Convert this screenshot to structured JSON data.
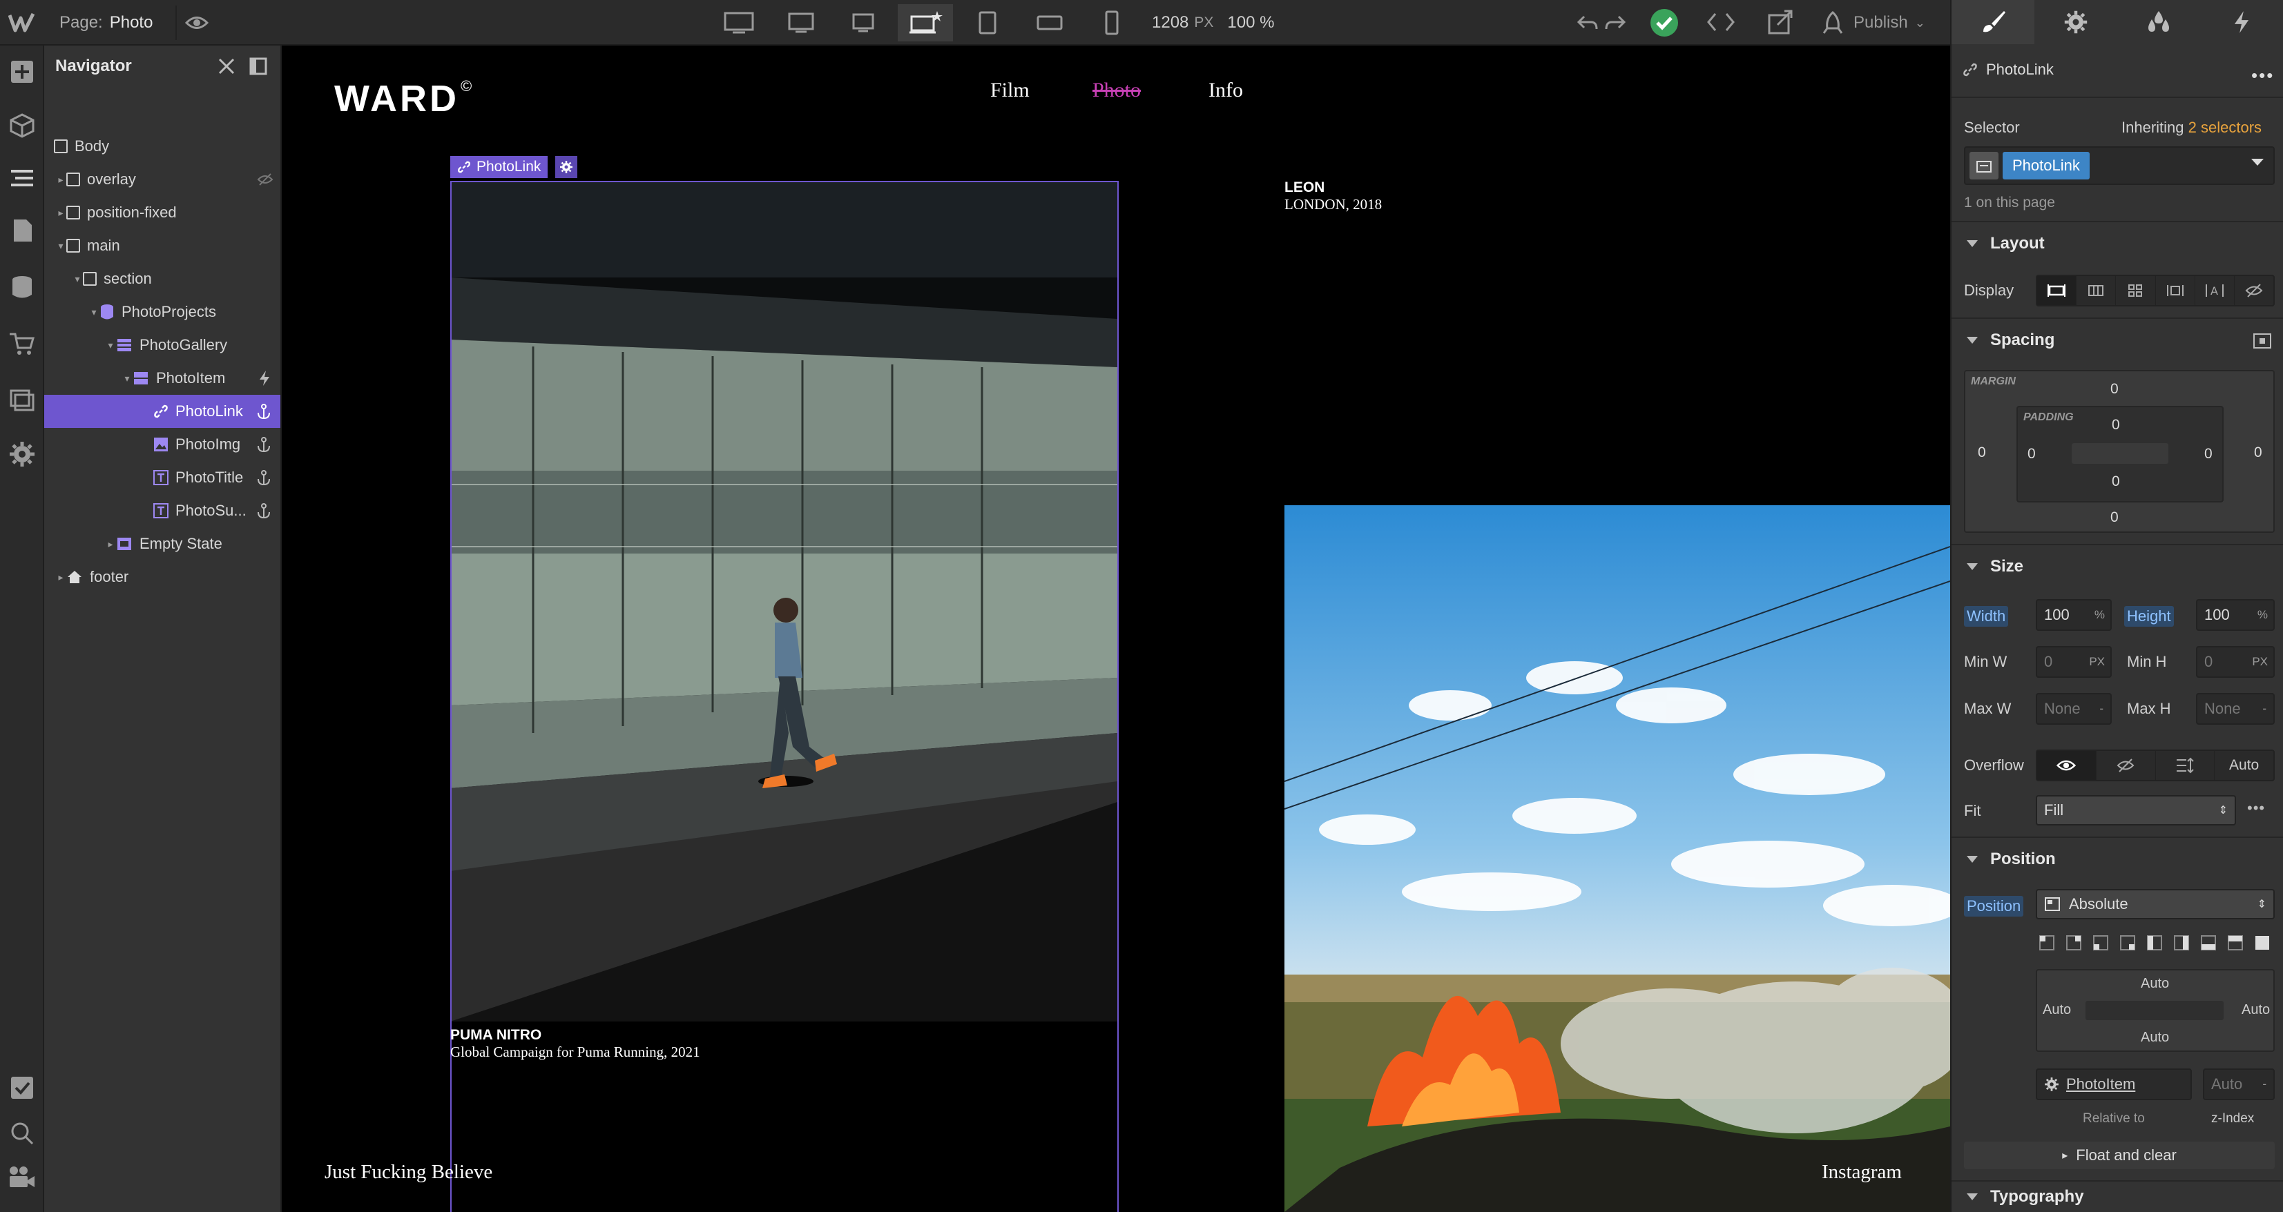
{
  "topbar": {
    "page_label": "Page:",
    "page_name": "Photo",
    "width_value": "1208",
    "width_unit": "PX",
    "zoom": "100 %",
    "publish_label": "Publish"
  },
  "navigator": {
    "title": "Navigator",
    "items": [
      {
        "label": "Body",
        "icon": "box-icon"
      },
      {
        "label": "overlay",
        "icon": "box-icon"
      },
      {
        "label": "position-fixed",
        "icon": "box-icon"
      },
      {
        "label": "main",
        "icon": "box-icon"
      },
      {
        "label": "section",
        "icon": "box-icon"
      },
      {
        "label": "PhotoProjects",
        "icon": "collection-icon"
      },
      {
        "label": "PhotoGallery",
        "icon": "collection-list-icon"
      },
      {
        "label": "PhotoItem",
        "icon": "collection-item-icon"
      },
      {
        "label": "PhotoLink",
        "icon": "link-icon"
      },
      {
        "label": "PhotoImg",
        "icon": "image-icon"
      },
      {
        "label": "PhotoTitle",
        "icon": "text-icon"
      },
      {
        "label": "PhotoSu...",
        "icon": "text-icon"
      },
      {
        "label": "Empty State",
        "icon": "empty-state-icon"
      },
      {
        "label": "footer",
        "icon": "home-icon"
      }
    ]
  },
  "site": {
    "logo": "WARD",
    "logo_mark": "©",
    "nav": [
      "Film",
      "Photo",
      "Info"
    ],
    "selected_tag": "PhotoLink",
    "project1_title": "PUMA NITRO",
    "project1_sub": "Global Campaign for Puma Running, 2021",
    "project2_title": "LEON",
    "project2_sub": "LONDON, 2018",
    "footer_left": "Just Fucking Believe",
    "footer_right": "Instagram"
  },
  "style": {
    "element_name": "PhotoLink",
    "selector_label": "Selector",
    "inheriting_prefix": "Inheriting",
    "inheriting_count": "2 selectors",
    "selector_chip": "PhotoLink",
    "on_page": "1 on this page",
    "layout": {
      "title": "Layout",
      "display_label": "Display"
    },
    "spacing": {
      "title": "Spacing",
      "margin_label": "MARGIN",
      "padding_label": "PADDING",
      "margin": {
        "top": "0",
        "right": "0",
        "bottom": "0",
        "left": "0"
      },
      "padding": {
        "top": "0",
        "right": "0",
        "bottom": "0",
        "left": "0"
      }
    },
    "size": {
      "title": "Size",
      "width_label": "Width",
      "width_value": "100",
      "width_unit": "%",
      "height_label": "Height",
      "height_value": "100",
      "height_unit": "%",
      "minw_label": "Min W",
      "minw_value": "0",
      "minw_unit": "PX",
      "minh_label": "Min H",
      "minh_value": "0",
      "minh_unit": "PX",
      "maxw_label": "Max W",
      "maxw_value": "None",
      "maxw_unit": "-",
      "maxh_label": "Max H",
      "maxh_value": "None",
      "maxh_unit": "-",
      "overflow_label": "Overflow",
      "overflow_auto": "Auto",
      "fit_label": "Fit",
      "fit_value": "Fill"
    },
    "position": {
      "title": "Position",
      "position_label": "Position",
      "position_value": "Absolute",
      "top": "Auto",
      "left": "Auto",
      "right": "Auto",
      "bottom": "Auto",
      "relative_item": "PhotoItem",
      "z_value": "Auto",
      "relative_to_label": "Relative to",
      "zindex_label": "z-Index",
      "float_label": "Float and clear"
    },
    "typography": {
      "title": "Typography"
    }
  },
  "colors": {
    "accent_purple": "#6e56cf",
    "link_pink": "#c941b6",
    "publish_green": "#3aa35b",
    "selector_blue": "#3d85c6",
    "inherit_orange": "#e8a33d"
  }
}
